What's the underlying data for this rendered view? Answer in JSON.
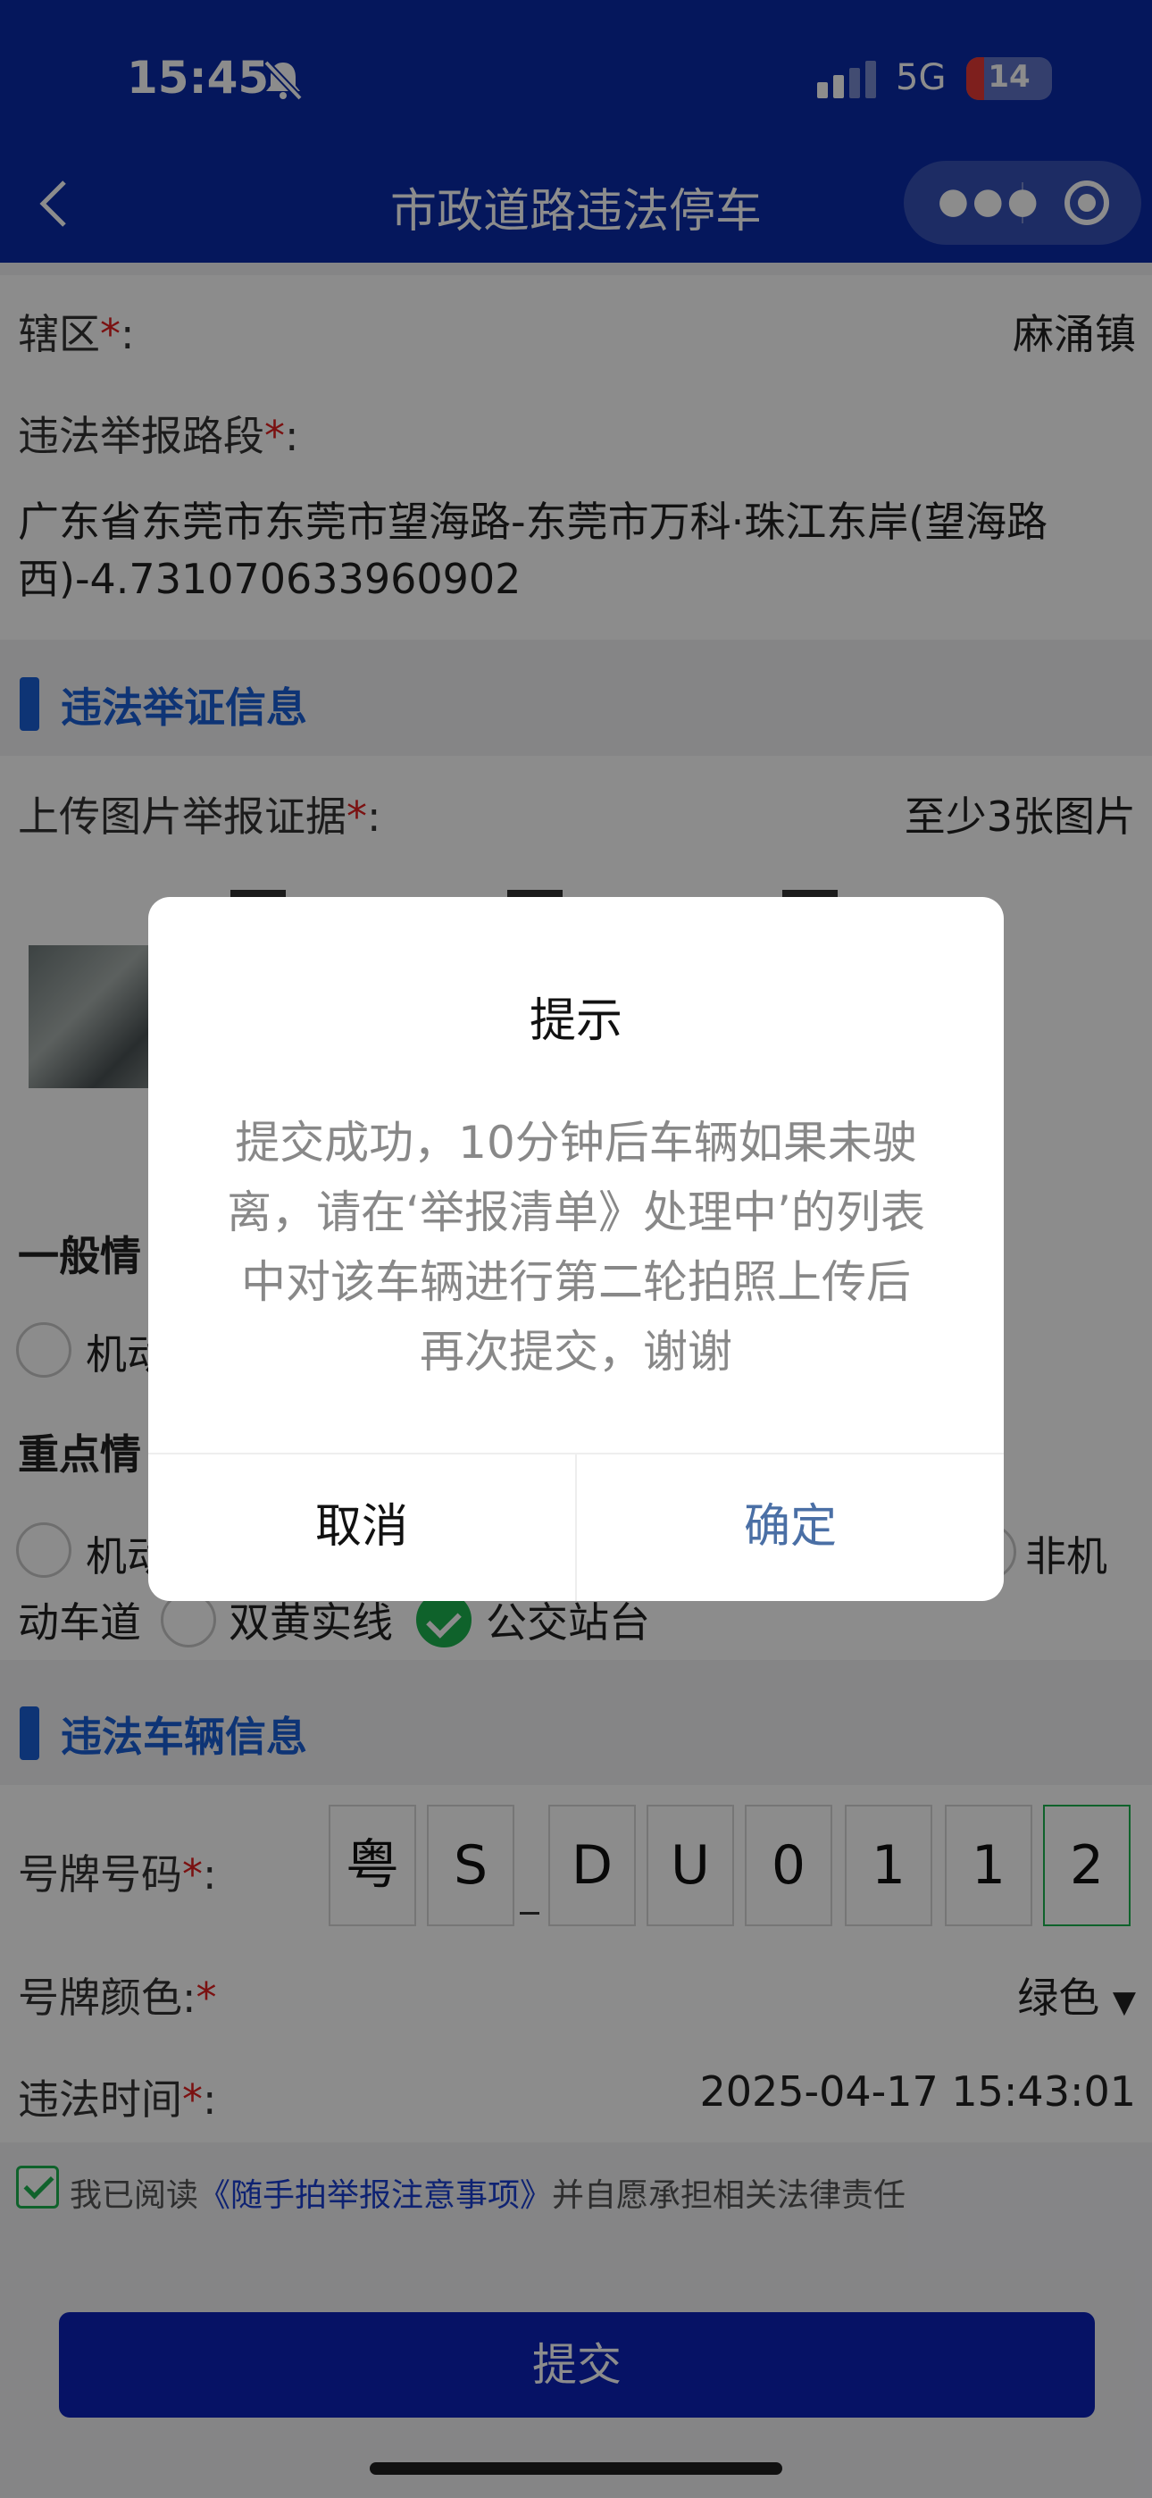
{
  "status_bar": {
    "time": "15:45",
    "network": "5G",
    "battery": "14"
  },
  "nav": {
    "title": "市政道路违法停车"
  },
  "district": {
    "label": "辖区",
    "value": "麻涌镇"
  },
  "road": {
    "label": "违法举报路段",
    "value": "广东省东莞市东莞市望海路-东莞市万科·珠江东岸(望海路西)-4.731070633960902"
  },
  "evidence_section": {
    "title": "违法举证信息"
  },
  "upload": {
    "label": "上传图片举报证据",
    "hint": "至少3张图片"
  },
  "general": {
    "label": "一般情",
    "option1": "机动"
  },
  "key": {
    "label": "重点情",
    "option1": "机动",
    "option_right": "非机",
    "option_line2_start": "动车道",
    "option_double_yellow": "双黄实线",
    "option_bus_stop": "公交站台"
  },
  "vehicle_section": {
    "title": "违法车辆信息"
  },
  "plate": {
    "label": "号牌号码",
    "chars": [
      "粤",
      "S",
      "D",
      "U",
      "0",
      "1",
      "1",
      "2"
    ]
  },
  "plate_color": {
    "label": "号牌颜色:",
    "value": "绿色"
  },
  "violation_time": {
    "label": "违法时间",
    "value": "2025-04-17 15:43:01"
  },
  "agreement": {
    "prefix": "我已阅读",
    "link": "《随手拍举报注意事项》",
    "suffix": "并自愿承担相关法律责任"
  },
  "submit": {
    "label": "提交"
  },
  "dialog": {
    "title": "提示",
    "message": "提交成功，10分钟后车辆如果未驶离，请在‘举报清单》处理中’的列表中对该车辆进行第二轮拍照上传后再次提交，谢谢",
    "cancel": "取消",
    "confirm": "确定"
  }
}
